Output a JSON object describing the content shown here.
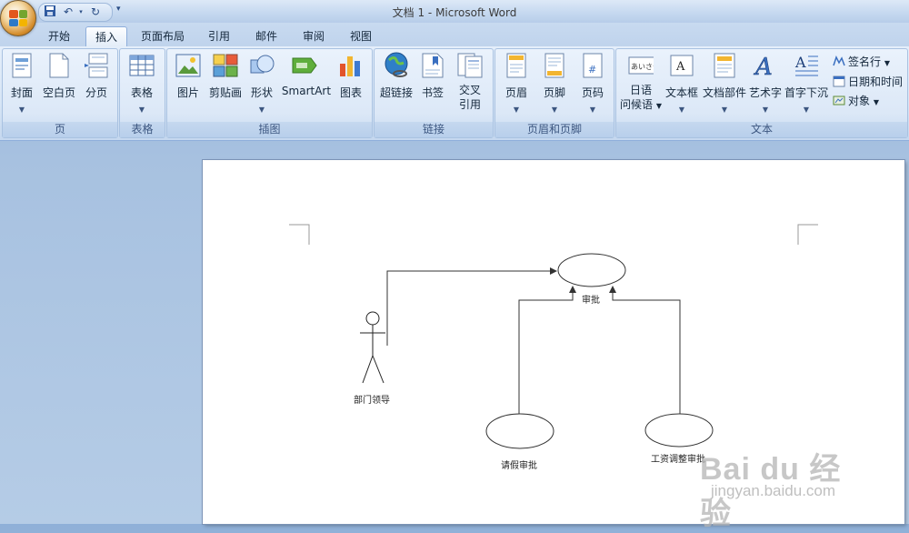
{
  "window": {
    "title": "文档 1 - Microsoft Word"
  },
  "quick_access": {
    "save_icon": "save-icon",
    "undo_icon": "undo-icon",
    "redo_icon": "redo-icon",
    "customize_icon": "customize-icon"
  },
  "tabs": [
    {
      "label": "开始"
    },
    {
      "label": "插入"
    },
    {
      "label": "页面布局"
    },
    {
      "label": "引用"
    },
    {
      "label": "邮件"
    },
    {
      "label": "审阅"
    },
    {
      "label": "视图"
    }
  ],
  "ribbon": {
    "page_group": {
      "label": "页",
      "cover": "封面",
      "blank": "空白页",
      "break": "分页"
    },
    "table_group": {
      "label": "表格",
      "table": "表格"
    },
    "illustrations_group": {
      "label": "插图",
      "picture": "图片",
      "clipart": "剪贴画",
      "shapes": "形状",
      "smartart": "SmartArt",
      "chart": "图表"
    },
    "links_group": {
      "label": "链接",
      "hyperlink": "超链接",
      "bookmark": "书签",
      "crossref_line1": "交叉",
      "crossref_line2": "引用"
    },
    "header_footer_group": {
      "label": "页眉和页脚",
      "header": "页眉",
      "footer": "页脚",
      "page_number": "页码"
    },
    "text_group": {
      "label": "文本",
      "japanese_line1": "日语",
      "japanese_line2": "问候语",
      "textbox": "文本框",
      "quickparts": "文档部件",
      "wordart": "艺术字",
      "dropcap": "首字下沉",
      "signature": "签名行",
      "datetime": "日期和时间",
      "object": "对象"
    }
  },
  "document": {
    "diagram": {
      "actor_label": "部门领导",
      "approve_label": "审批",
      "leave_label": "请假审批",
      "salary_label": "工资调整审批"
    }
  },
  "watermark": {
    "logo": "Bai du 经验",
    "url": "jingyan.baidu.com"
  },
  "colors": {
    "ribbon_bg": "#dce8f7",
    "active_tab": "#fdfeff",
    "workspace_bg": "#a7c1e0",
    "page_bg": "#ffffff"
  }
}
